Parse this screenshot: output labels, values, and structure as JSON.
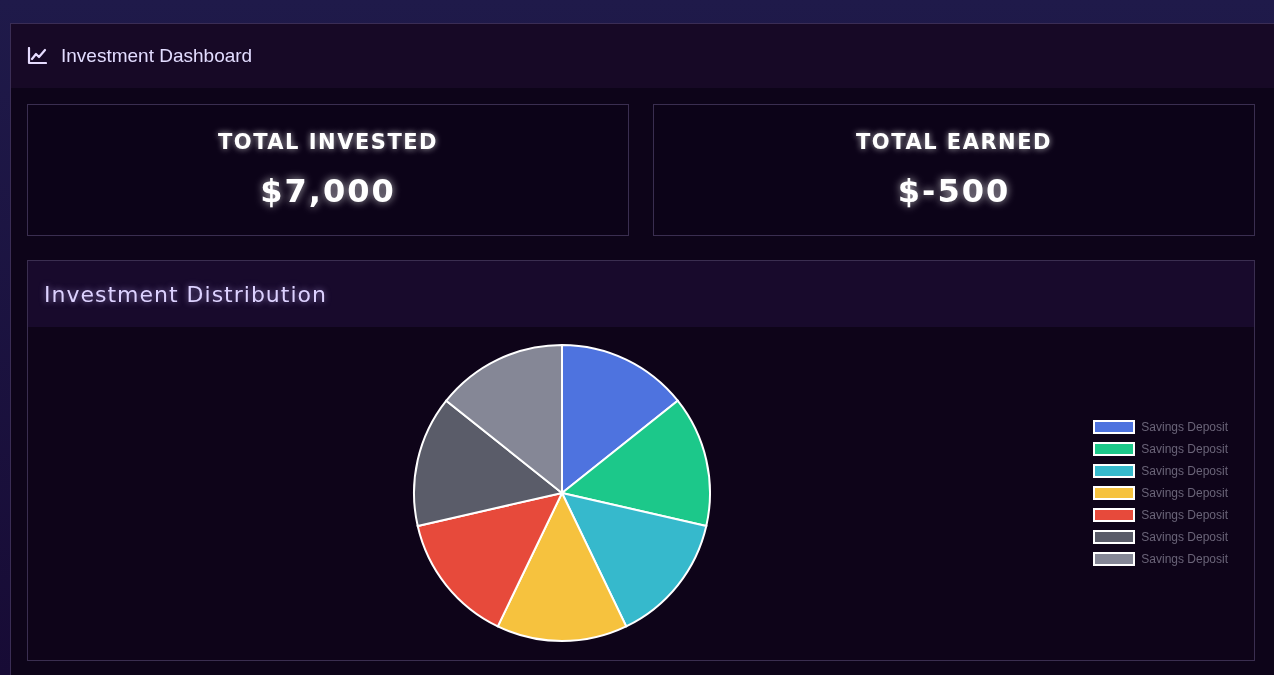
{
  "header": {
    "title": "Investment Dashboard"
  },
  "stats": [
    {
      "label": "TOTAL INVESTED",
      "value": "$7,000"
    },
    {
      "label": "TOTAL EARNED",
      "value": "$-500"
    }
  ],
  "distribution": {
    "title": "Investment Distribution",
    "legend": [
      {
        "label": "Savings Deposit",
        "color": "#4e73df"
      },
      {
        "label": "Savings Deposit",
        "color": "#1cc88a"
      },
      {
        "label": "Savings Deposit",
        "color": "#36b9cc"
      },
      {
        "label": "Savings Deposit",
        "color": "#f6c23e"
      },
      {
        "label": "Savings Deposit",
        "color": "#e74a3b"
      },
      {
        "label": "Savings Deposit",
        "color": "#5a5c69"
      },
      {
        "label": "Savings Deposit",
        "color": "#858796"
      }
    ]
  }
}
